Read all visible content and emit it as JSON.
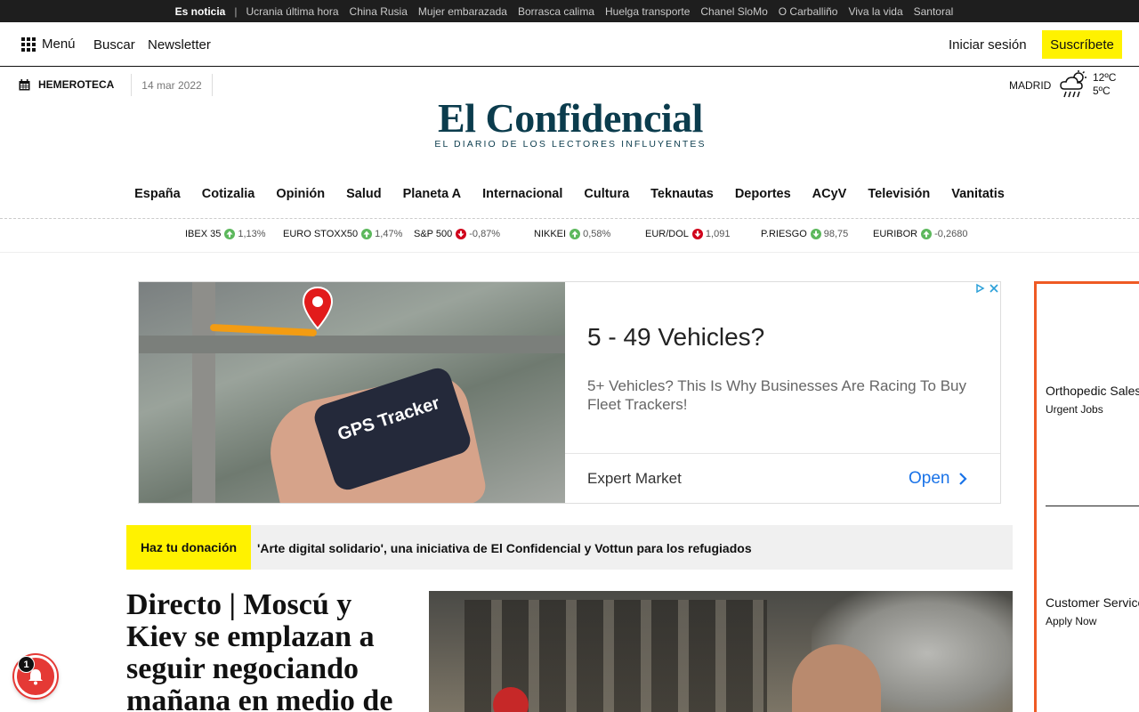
{
  "trending": {
    "lead": "Es noticia",
    "items": [
      "Ucrania última hora",
      "China Rusia",
      "Mujer embarazada",
      "Borrasca calima",
      "Huelga transporte",
      "Chanel SloMo",
      "O Carballiño",
      "Viva la vida",
      "Santoral"
    ]
  },
  "nav": {
    "menu_label": "Menú",
    "search_label": "Buscar",
    "newsletter_label": "Newsletter",
    "login_label": "Iniciar sesión",
    "subscribe_label": "Suscríbete"
  },
  "header": {
    "archive_label": "HEMEROTECA",
    "date": "14 mar 2022",
    "logo_title": "El Confidencial",
    "logo_tagline": "EL DIARIO DE LOS LECTORES INFLUYENTES",
    "weather": {
      "city": "MADRID",
      "high": "12ºC",
      "low": "5ºC",
      "icon": "rain-cloud-icon"
    }
  },
  "sections": [
    "España",
    "Cotizalia",
    "Opinión",
    "Salud",
    "Planeta A",
    "Internacional",
    "Cultura",
    "Teknautas",
    "Deportes",
    "ACyV",
    "Televisión",
    "Vanitatis"
  ],
  "ticker": [
    {
      "name": "IBEX 35",
      "direction": "up",
      "value": "1,13%"
    },
    {
      "name": "EURO STOXX50",
      "direction": "up",
      "value": "1,47%"
    },
    {
      "name": "S&P 500",
      "direction": "down",
      "value": "-0,87%"
    },
    {
      "name": "NIKKEI",
      "direction": "up",
      "value": "0,58%"
    },
    {
      "name": "EUR/DOL",
      "direction": "down",
      "value": "1,091"
    },
    {
      "name": "P.RIESGO",
      "direction": "down",
      "value": "98,75"
    },
    {
      "name": "EURIBOR",
      "direction": "up",
      "value": "-0,2680"
    }
  ],
  "ad": {
    "image_text": "GPS Tracker",
    "title": "5 - 49 Vehicles?",
    "description": "5+ Vehicles? This Is Why Businesses Are Racing To Buy Fleet Trackers!",
    "brand": "Expert Market",
    "cta": "Open"
  },
  "donation": {
    "button_label": "Haz tu donación",
    "text": "'Arte digital solidario', una iniciativa de El Confidencial y Vottun para los refugiados"
  },
  "headline": "Directo | Moscú y Kiev se emplazan a seguir negociando mañana en medio de",
  "right_ad": {
    "items": [
      {
        "title": "Orthopedic Sales",
        "subtitle": "Urgent Jobs"
      },
      {
        "title": "Customer Service",
        "subtitle": "Apply Now"
      }
    ]
  },
  "notifications": {
    "count": "1"
  },
  "colors": {
    "accent_yellow": "#fff200",
    "brand_blue": "#0b3c4d",
    "up": "#5cb85c",
    "down": "#d0021b",
    "right_ad_border": "#ef5a24"
  }
}
